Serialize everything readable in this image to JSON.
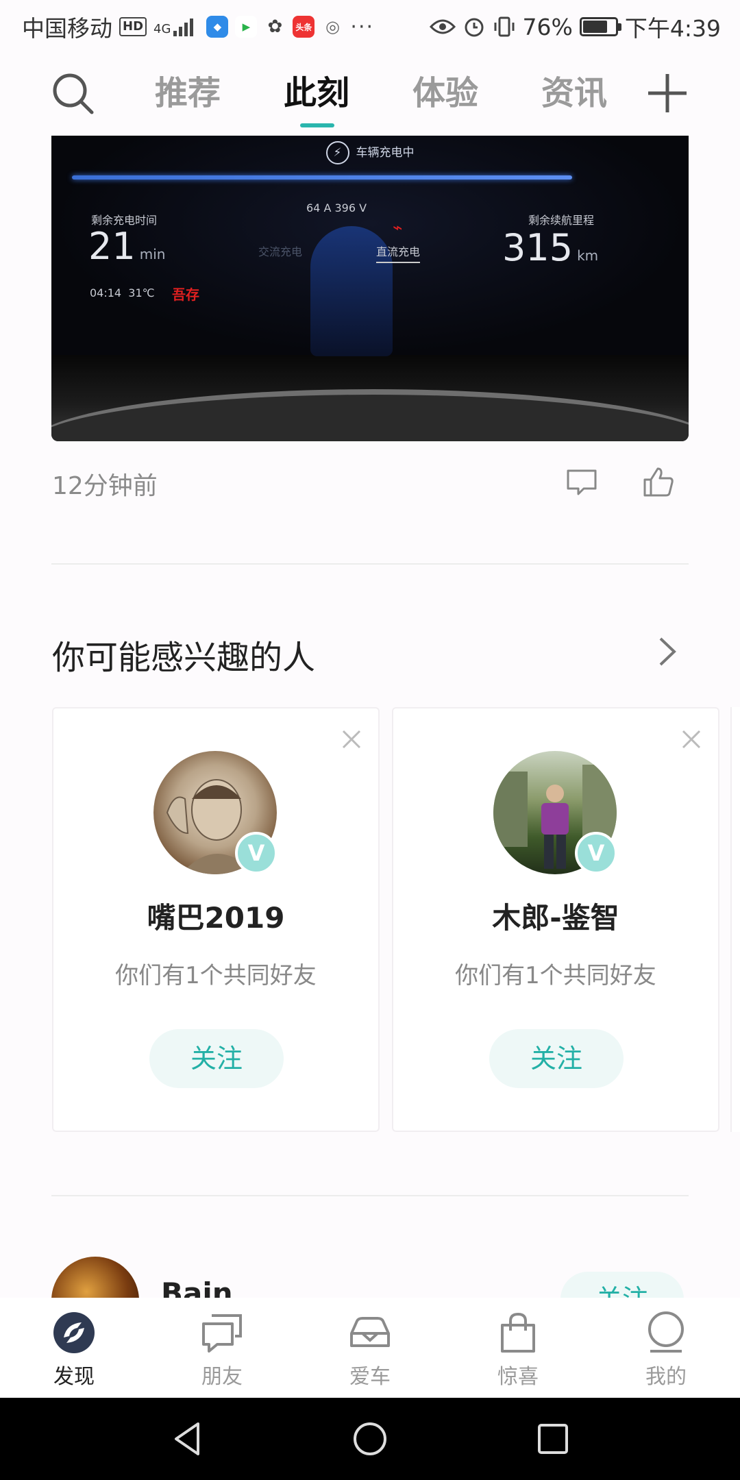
{
  "status_bar": {
    "carrier": "中国移动",
    "hd": "HD",
    "signal": "4G",
    "battery_percent": "76%",
    "battery_level": 0.76,
    "time": "下午4:39",
    "more": "···"
  },
  "nav": {
    "tabs": [
      {
        "label": "推荐",
        "active": false
      },
      {
        "label": "此刻",
        "active": true
      },
      {
        "label": "体验",
        "active": false
      },
      {
        "label": "资讯",
        "active": false
      }
    ]
  },
  "post": {
    "photo": {
      "charging_status": "车辆充电中",
      "remaining_time_label": "剩余充电时间",
      "remaining_time_value": "21",
      "remaining_time_unit": "min",
      "clock": "04:14",
      "temperature": "31℃",
      "current_voltage": "64 A  396 V",
      "ac_label": "交流充电",
      "dc_label": "直流充电",
      "range_label": "剩余续航里程",
      "range_value": "315",
      "range_unit": "km"
    },
    "time_ago": "12分钟前"
  },
  "people": {
    "title": "你可能感兴趣的人",
    "cards": [
      {
        "name": "嘴巴2019",
        "mutual": "你们有1个共同好友",
        "follow": "关注",
        "badge": "V"
      },
      {
        "name": "木郎-鉴智",
        "mutual": "你们有1个共同好友",
        "follow": "关注",
        "badge": "V"
      }
    ]
  },
  "next_item": {
    "name": "Bain",
    "follow": "关注"
  },
  "bottom_nav": [
    {
      "label": "发现",
      "icon": "discover-icon",
      "active": true
    },
    {
      "label": "朋友",
      "icon": "friends-icon",
      "active": false
    },
    {
      "label": "爱车",
      "icon": "car-icon",
      "active": false
    },
    {
      "label": "惊喜",
      "icon": "shopping-bag-icon",
      "active": false
    },
    {
      "label": "我的",
      "icon": "profile-icon",
      "active": false
    }
  ],
  "colors": {
    "accent": "#2ab5ad",
    "follow_text": "#23b0a6",
    "follow_bg": "#eef8f7"
  }
}
